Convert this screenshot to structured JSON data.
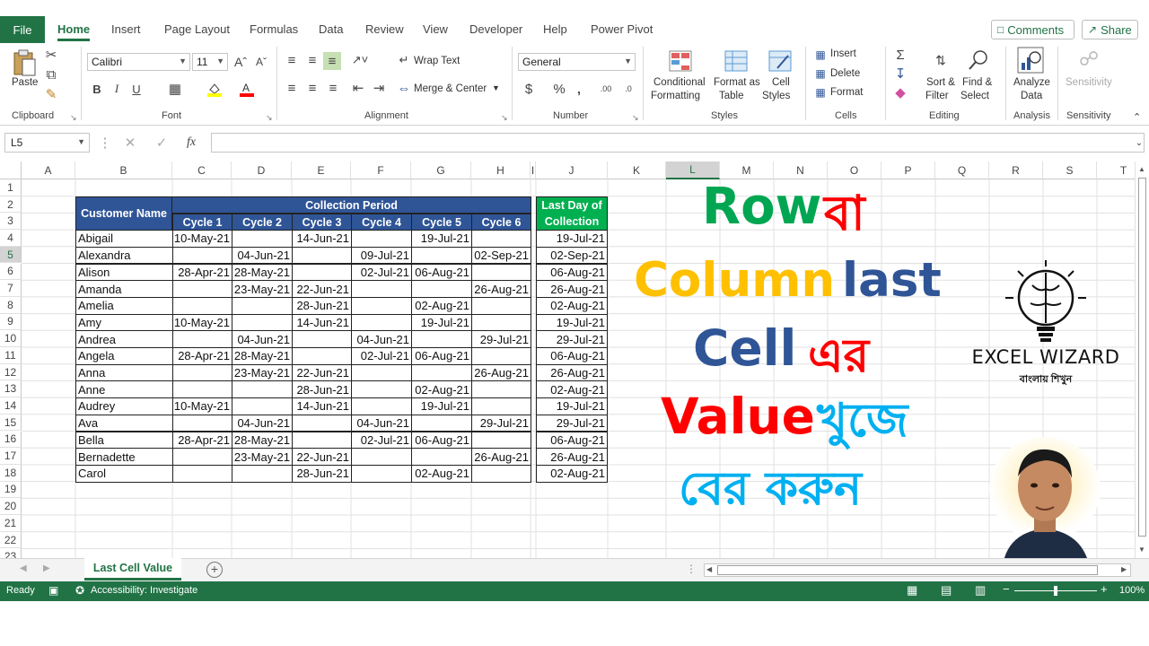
{
  "ribbon_tabs": [
    "File",
    "Home",
    "Insert",
    "Page Layout",
    "Formulas",
    "Data",
    "Review",
    "View",
    "Developer",
    "Help",
    "Power Pivot"
  ],
  "active_tab": "Home",
  "header_buttons": {
    "comments": "Comments",
    "share": "Share"
  },
  "clipboard": {
    "paste": "Paste",
    "group": "Clipboard"
  },
  "font": {
    "name": "Calibri",
    "size": "11",
    "group": "Font"
  },
  "alignment": {
    "wrap_text": "Wrap Text",
    "merge_center": "Merge & Center",
    "group": "Alignment"
  },
  "number": {
    "format": "General",
    "group": "Number"
  },
  "styles": {
    "conditional": [
      "Conditional",
      "Formatting"
    ],
    "format_table": [
      "Format as",
      "Table"
    ],
    "cell_styles": [
      "Cell",
      "Styles"
    ],
    "group": "Styles"
  },
  "cells": {
    "insert": "Insert",
    "delete": "Delete",
    "format": "Format",
    "group": "Cells"
  },
  "editing": {
    "sort_filter": [
      "Sort &",
      "Filter"
    ],
    "find_select": [
      "Find &",
      "Select"
    ],
    "group": "Editing"
  },
  "analysis": {
    "analyze": [
      "Analyze",
      "Data"
    ],
    "group": "Analysis"
  },
  "sensitivity": {
    "label": "Sensitivity",
    "group": "Sensitivity"
  },
  "name_box": "L5",
  "formula_value": "",
  "columns": [
    "A",
    "B",
    "C",
    "D",
    "E",
    "F",
    "G",
    "H",
    "I",
    "J",
    "K",
    "L",
    "M",
    "N",
    "O",
    "P",
    "Q",
    "R",
    "S",
    "T"
  ],
  "selected_column": "L",
  "rows": [
    "1",
    "2",
    "3",
    "4",
    "5",
    "6",
    "7",
    "8",
    "9",
    "10",
    "11",
    "12",
    "13",
    "14",
    "15",
    "16",
    "17",
    "18",
    "19",
    "20",
    "21",
    "22",
    "23"
  ],
  "selected_row": "5",
  "table": {
    "customer_header": "Customer Name",
    "period_header": "Collection Period",
    "cycles": [
      "Cycle 1",
      "Cycle 2",
      "Cycle 3",
      "Cycle 4",
      "Cycle 5",
      "Cycle 6"
    ],
    "last_day_header": [
      "Last Day of",
      "Collection"
    ],
    "rows": [
      {
        "name": "Abigail",
        "c": [
          "10-May-21",
          "",
          "14-Jun-21",
          "",
          "19-Jul-21",
          ""
        ],
        "last": "19-Jul-21"
      },
      {
        "name": "Alexandra",
        "c": [
          "",
          "04-Jun-21",
          "",
          "09-Jul-21",
          "",
          "02-Sep-21"
        ],
        "last": "02-Sep-21"
      },
      {
        "name": "Alison",
        "c": [
          "28-Apr-21",
          "28-May-21",
          "",
          "02-Jul-21",
          "06-Aug-21",
          ""
        ],
        "last": "06-Aug-21"
      },
      {
        "name": "Amanda",
        "c": [
          "",
          "23-May-21",
          "22-Jun-21",
          "",
          "",
          "26-Aug-21"
        ],
        "last": "26-Aug-21"
      },
      {
        "name": "Amelia",
        "c": [
          "",
          "",
          "28-Jun-21",
          "",
          "02-Aug-21",
          ""
        ],
        "last": "02-Aug-21"
      },
      {
        "name": "Amy",
        "c": [
          "10-May-21",
          "",
          "14-Jun-21",
          "",
          "19-Jul-21",
          ""
        ],
        "last": "19-Jul-21"
      },
      {
        "name": "Andrea",
        "c": [
          "",
          "04-Jun-21",
          "",
          "04-Jun-21",
          "",
          "29-Jul-21"
        ],
        "last": "29-Jul-21"
      },
      {
        "name": "Angela",
        "c": [
          "28-Apr-21",
          "28-May-21",
          "",
          "02-Jul-21",
          "06-Aug-21",
          ""
        ],
        "last": "06-Aug-21"
      },
      {
        "name": "Anna",
        "c": [
          "",
          "23-May-21",
          "22-Jun-21",
          "",
          "",
          "26-Aug-21"
        ],
        "last": "26-Aug-21"
      },
      {
        "name": "Anne",
        "c": [
          "",
          "",
          "28-Jun-21",
          "",
          "02-Aug-21",
          ""
        ],
        "last": "02-Aug-21"
      },
      {
        "name": "Audrey",
        "c": [
          "10-May-21",
          "",
          "14-Jun-21",
          "",
          "19-Jul-21",
          ""
        ],
        "last": "19-Jul-21"
      },
      {
        "name": "Ava",
        "c": [
          "",
          "04-Jun-21",
          "",
          "04-Jun-21",
          "",
          "29-Jul-21"
        ],
        "last": "29-Jul-21"
      },
      {
        "name": "Bella",
        "c": [
          "28-Apr-21",
          "28-May-21",
          "",
          "02-Jul-21",
          "06-Aug-21",
          ""
        ],
        "last": "06-Aug-21"
      },
      {
        "name": "Bernadette",
        "c": [
          "",
          "23-May-21",
          "22-Jun-21",
          "",
          "",
          "26-Aug-21"
        ],
        "last": "26-Aug-21"
      },
      {
        "name": "Carol",
        "c": [
          "",
          "",
          "28-Jun-21",
          "",
          "02-Aug-21",
          ""
        ],
        "last": "02-Aug-21"
      }
    ]
  },
  "overlay": {
    "line1a": "Row",
    "line1b": "বা",
    "line2a": "Column",
    "line2b": "last",
    "line3a": "Cell",
    "line3b": "এর",
    "line4a": "Value",
    "line4b": "খুজে",
    "line5": "বের করুন",
    "colors": {
      "green": "#00a651",
      "red": "#ff0000",
      "yellow": "#ffc000",
      "blue": "#2f5597",
      "cyan": "#00b0f0"
    }
  },
  "logo": {
    "title": "EXCEL WIZARD",
    "subtitle": "বাংলায় শিখুন"
  },
  "sheet_tab": "Last Cell Value",
  "status": {
    "ready": "Ready",
    "accessibility": "Accessibility: Investigate",
    "zoom": "100%"
  },
  "accent_color": "#217346"
}
